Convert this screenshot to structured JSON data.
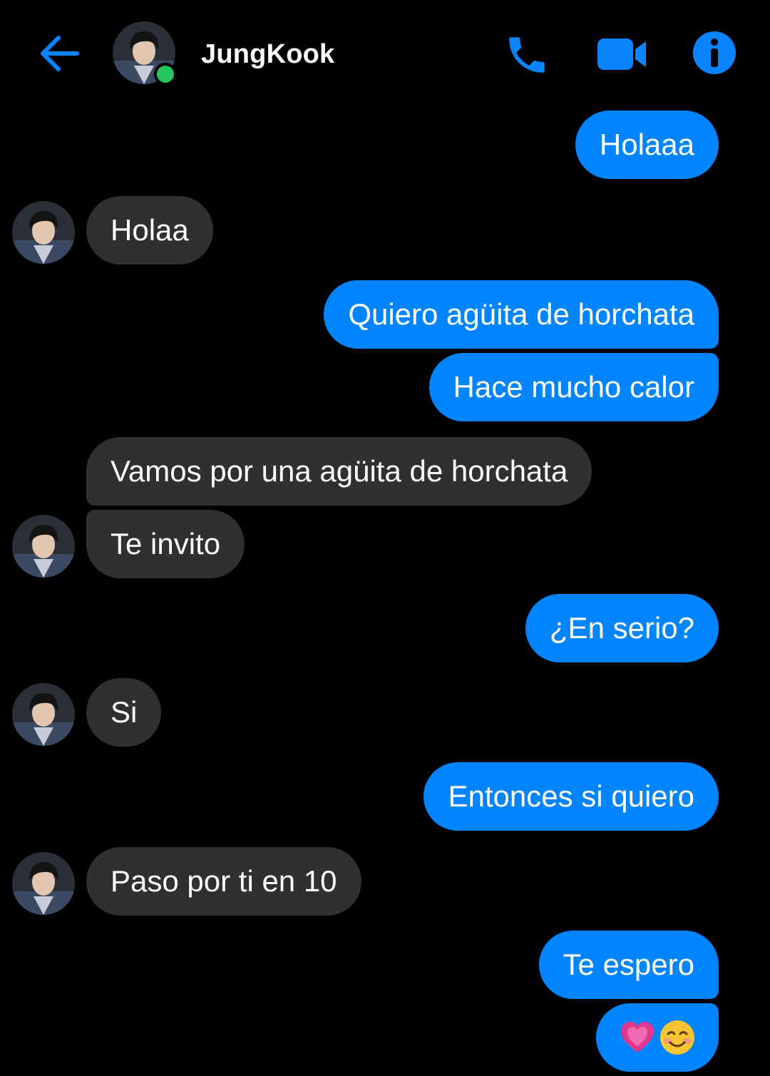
{
  "header": {
    "contact_name": "JungKook",
    "online_status_color": "#22c55e",
    "icons": {
      "back": "arrow-left-icon",
      "call": "phone-icon",
      "video": "video-camera-icon",
      "info": "info-icon"
    }
  },
  "colors": {
    "accent": "#0084ff",
    "sent_bubble": "#0084ff",
    "received_bubble": "#303030",
    "background": "#000000"
  },
  "messages": [
    {
      "from": "me",
      "text": "Holaaa"
    },
    {
      "from": "contact",
      "text": "Holaa"
    },
    {
      "from": "me",
      "text": "Quiero agüita de horchata"
    },
    {
      "from": "me",
      "text": "Hace mucho calor"
    },
    {
      "from": "contact",
      "text": "Vamos por una agüita de horchata"
    },
    {
      "from": "contact",
      "text": "Te invito"
    },
    {
      "from": "me",
      "text": "¿En serio?"
    },
    {
      "from": "contact",
      "text": "Si"
    },
    {
      "from": "me",
      "text": "Entonces si quiero"
    },
    {
      "from": "contact",
      "text": "Paso por ti en 10"
    },
    {
      "from": "me",
      "text": "Te espero"
    },
    {
      "from": "me",
      "emojis": [
        "growing-heart-emoji",
        "smiling-face-emoji"
      ]
    }
  ]
}
